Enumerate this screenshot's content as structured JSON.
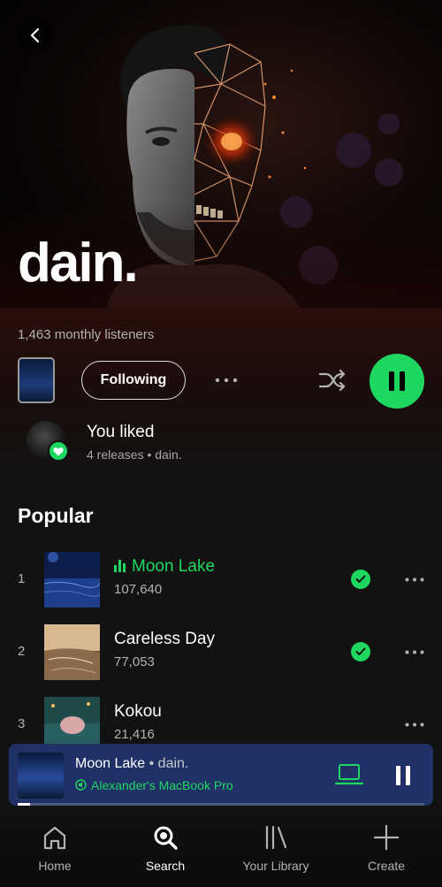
{
  "artist": {
    "name": "dain.",
    "monthly_listeners": "1,463 monthly listeners"
  },
  "controls": {
    "follow_label": "Following"
  },
  "liked": {
    "title": "You liked",
    "subtitle": "4 releases • dain."
  },
  "popular": {
    "section_title": "Popular",
    "tracks": [
      {
        "number": "1",
        "title": "Moon Lake",
        "plays": "107,640",
        "liked": true,
        "playing": true
      },
      {
        "number": "2",
        "title": "Careless Day",
        "plays": "77,053",
        "liked": true,
        "playing": false
      },
      {
        "number": "3",
        "title": "Kokou",
        "plays": "21,416",
        "liked": false,
        "playing": false
      }
    ]
  },
  "now_playing": {
    "title": "Moon Lake",
    "separator": " • ",
    "artist": "dain.",
    "device": "Alexander's MacBook Pro",
    "progress": 0.03
  },
  "nav": {
    "items": [
      {
        "label": "Home",
        "icon": "home-icon"
      },
      {
        "label": "Search",
        "icon": "search-icon",
        "active": true
      },
      {
        "label": "Your Library",
        "icon": "library-icon"
      },
      {
        "label": "Create",
        "icon": "plus-icon"
      }
    ]
  },
  "colors": {
    "accent": "#1ed760",
    "background": "#121212",
    "now_playing_bg": "#1f3166"
  }
}
